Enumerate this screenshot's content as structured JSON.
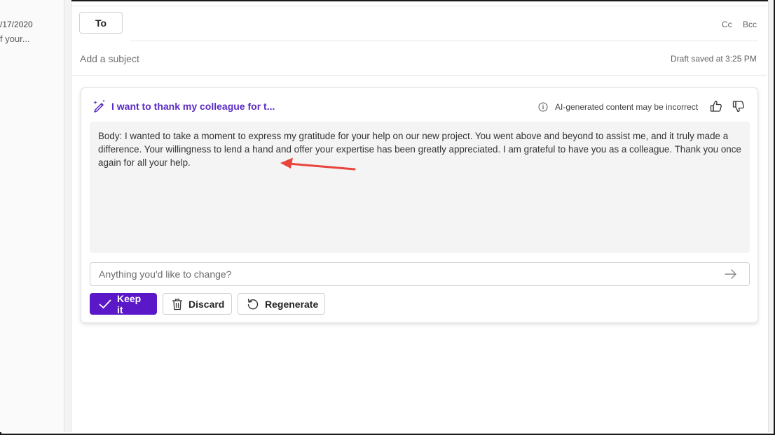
{
  "message_list": {
    "date": "/17/2020",
    "preview": "f your..."
  },
  "compose": {
    "to_label": "To",
    "cc_label": "Cc",
    "bcc_label": "Bcc",
    "subject_placeholder": "Add a subject",
    "draft_status": "Draft saved at 3:25 PM"
  },
  "copilot": {
    "prompt_title": "I want to thank my colleague for t...",
    "ai_disclaimer": "AI-generated content may be incorrect",
    "body_text": "Body: I wanted to take a moment to express my gratitude for your help on our new project. You went above and beyond to assist me, and it truly made a difference. Your willingness to lend a hand and offer your expertise has been greatly appreciated. I am grateful to have you as a colleague. Thank you once again for all your help.",
    "change_placeholder": "Anything you'd like to change?",
    "keep_label": "Keep it",
    "discard_label": "Discard",
    "regenerate_label": "Regenerate"
  },
  "colors": {
    "accent": "#5b18c8",
    "title_purple": "#5b2bc4",
    "annotation_arrow": "#e8453c"
  },
  "icons": [
    "copilot-pen-icon",
    "info-icon",
    "thumbs-up-icon",
    "thumbs-down-icon",
    "send-arrow-icon",
    "checkmark-icon",
    "trash-icon",
    "regenerate-icon",
    "annotation-arrow-icon"
  ]
}
